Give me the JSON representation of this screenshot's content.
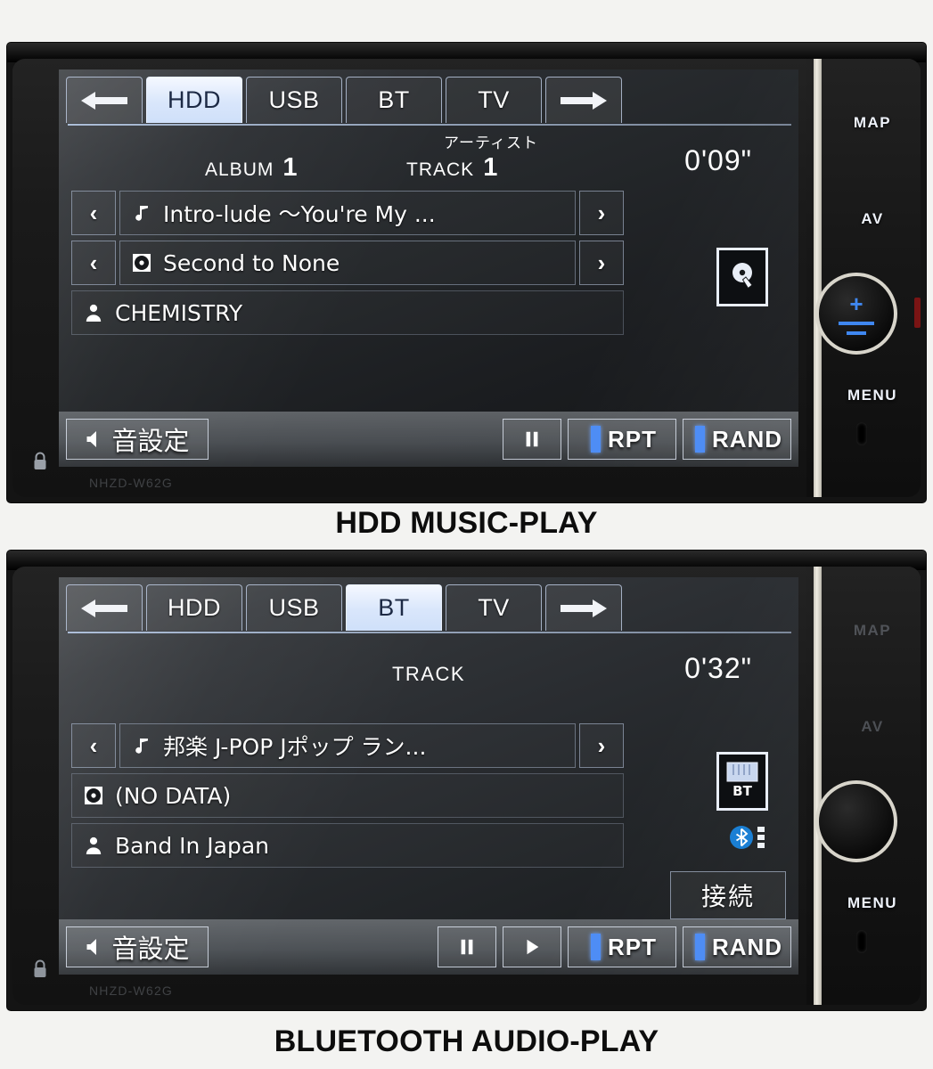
{
  "panels": [
    {
      "caption": "HDD MUSIC-PLAY",
      "model_text": "NHZD-W62G",
      "tabs": [
        {
          "label": "",
          "icon": "arrow-left-icon",
          "active": false
        },
        {
          "label": "HDD",
          "active": true
        },
        {
          "label": "USB",
          "active": false
        },
        {
          "label": "BT",
          "active": false
        },
        {
          "label": "TV",
          "active": false
        },
        {
          "label": "",
          "icon": "arrow-right-icon",
          "active": false
        }
      ],
      "info": {
        "album_label": "ALBUM",
        "album_value": "1",
        "artist_caption": "アーティスト",
        "track_label": "TRACK",
        "track_value": "1",
        "elapsed_time": "0'09\""
      },
      "rows": [
        {
          "icon": "music-note-icon",
          "text": "Intro-lude 〜You're My ...",
          "has_nav": true
        },
        {
          "icon": "disc-icon",
          "text": "Second to None",
          "has_nav": true
        },
        {
          "icon": "person-icon",
          "text": "CHEMISTRY",
          "has_nav": false
        }
      ],
      "source_icon": "hdd-icon",
      "controls": {
        "sound_label": "音設定",
        "buttons": [
          {
            "name": "pause",
            "glyph": "pause",
            "label": "",
            "led": false
          },
          {
            "name": "repeat",
            "glyph": "",
            "label": "RPT",
            "led": true
          },
          {
            "name": "random",
            "glyph": "",
            "label": "RAND",
            "led": true
          }
        ]
      },
      "hardware": {
        "map": "MAP",
        "av": "AV",
        "menu": "MENU",
        "knob_plus": "+",
        "knob_minus": "−",
        "buttons_visible": true
      }
    },
    {
      "caption": "BLUETOOTH AUDIO-PLAY",
      "model_text": "NHZD-W62G",
      "tabs": [
        {
          "label": "",
          "icon": "arrow-left-icon",
          "active": false
        },
        {
          "label": "HDD",
          "active": false
        },
        {
          "label": "USB",
          "active": false
        },
        {
          "label": "BT",
          "active": true
        },
        {
          "label": "TV",
          "active": false
        },
        {
          "label": "",
          "icon": "arrow-right-icon",
          "active": false
        }
      ],
      "info": {
        "track_label": "TRACK",
        "elapsed_time": "0'32\""
      },
      "rows": [
        {
          "icon": "music-note-icon",
          "text": "邦楽 J-POP Jポップ ラン...",
          "has_nav": true
        },
        {
          "icon": "disc-icon",
          "text": "(NO DATA)",
          "has_nav": false
        },
        {
          "icon": "person-icon",
          "text": "Band In Japan",
          "has_nav": false
        }
      ],
      "source_icon": "bt-device-icon",
      "source_icon_label": "BT",
      "bt_status_icon": "bluetooth-icon",
      "connect_label": "接続",
      "controls": {
        "sound_label": "音設定",
        "buttons": [
          {
            "name": "pause",
            "glyph": "pause",
            "label": "",
            "led": false
          },
          {
            "name": "play",
            "glyph": "play",
            "label": "",
            "led": false
          },
          {
            "name": "repeat",
            "glyph": "",
            "label": "RPT",
            "led": true
          },
          {
            "name": "random",
            "glyph": "",
            "label": "RAND",
            "led": true
          }
        ]
      },
      "hardware": {
        "map": "MAP",
        "av": "AV",
        "menu": "MENU",
        "knob_plus": "",
        "knob_minus": "",
        "buttons_visible": false
      }
    }
  ],
  "colors": {
    "tab_active_bg": "#d9e6fb",
    "tab_active_text": "#1d2a45",
    "led_blue": "#4e8df5",
    "knob_blue": "#3f87f0",
    "bluetooth_blue": "#1a7fd4",
    "lcd_text": "#ffffff"
  }
}
